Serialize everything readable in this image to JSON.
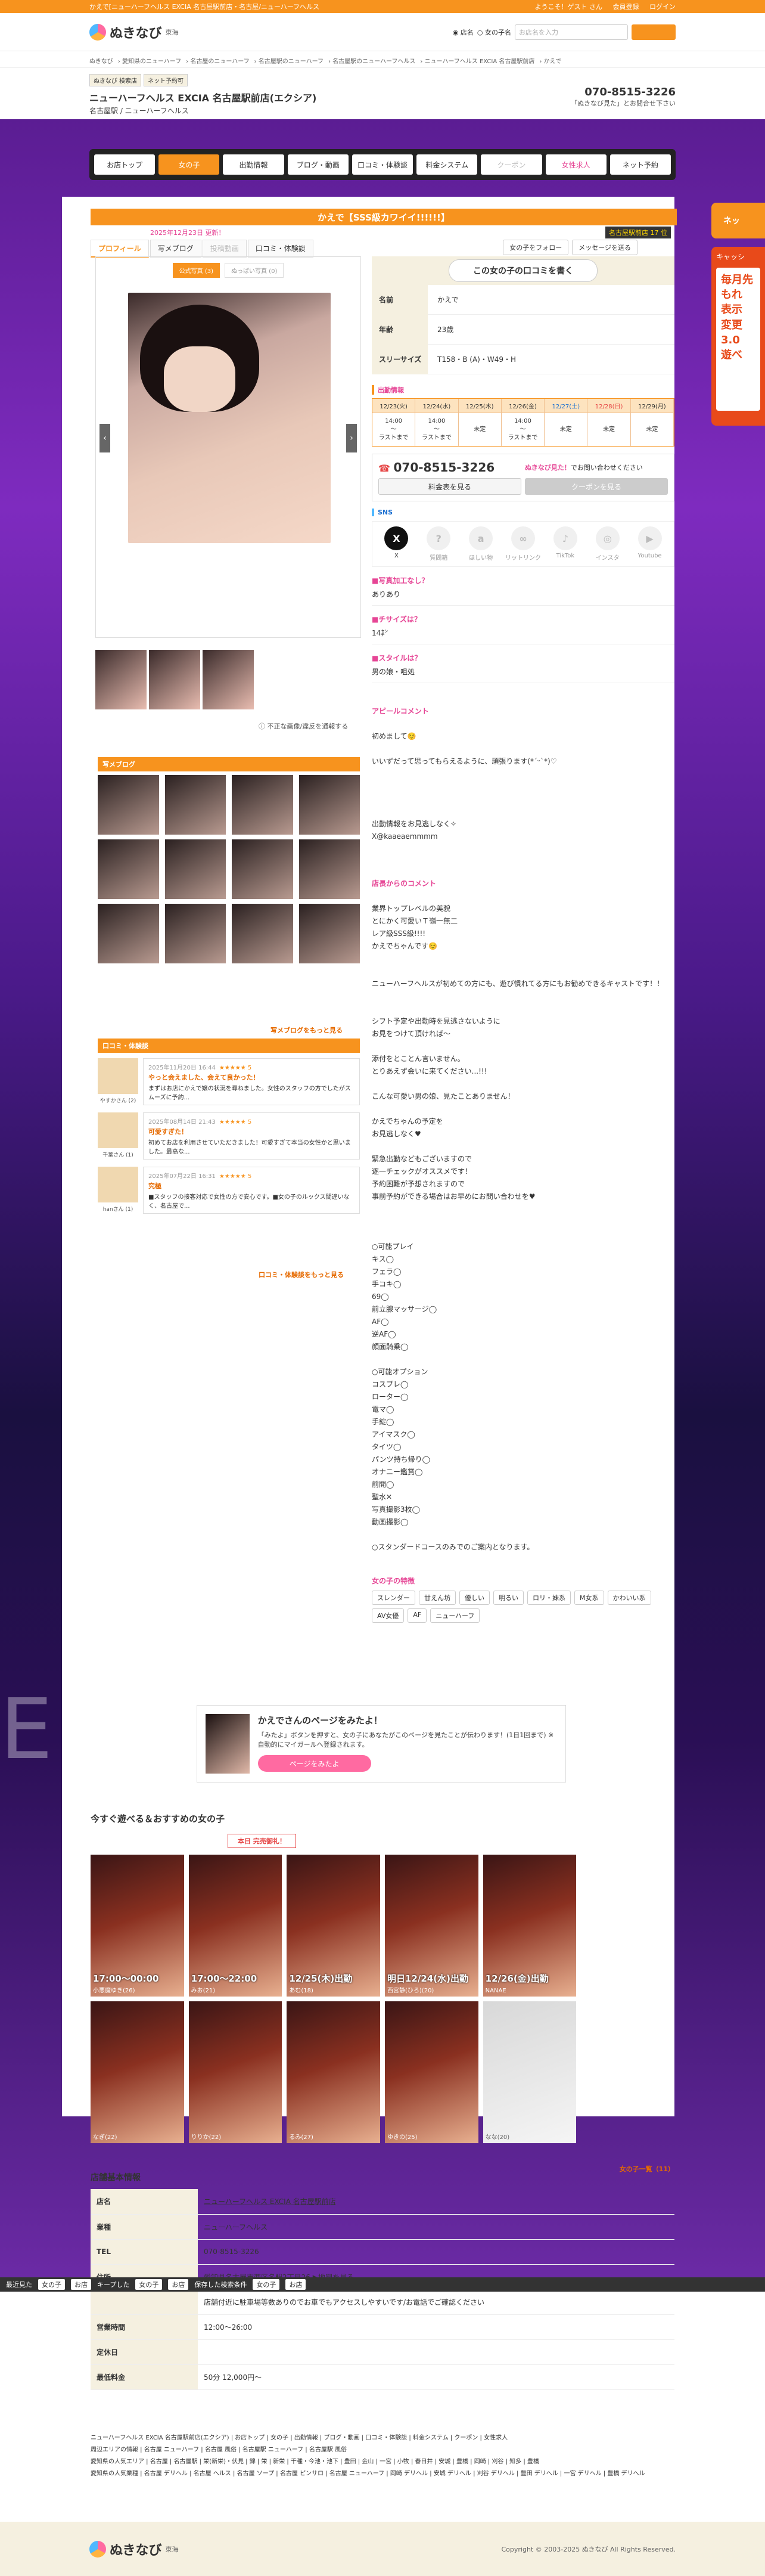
{
  "topline": {
    "left": "かえで[ニューハーフヘルス EXCIA 名古屋駅前店・名古屋/ニューハーフヘルス",
    "links": [
      "ようこそ！ゲスト さん",
      "会員登録",
      "ログイン"
    ]
  },
  "header": {
    "logo": "ぬきなび",
    "region": "東海",
    "search_scope_1": "店名",
    "search_scope_2": "女の子名",
    "search_placeholder": "お店名を入力"
  },
  "breadcrumb": [
    "ぬきなび",
    "愛知県のニューハーフ",
    "名古屋のニューハーフ",
    "名古屋駅のニューハーフ",
    "名古屋駅のニューハーフヘルス",
    "ニューハーフヘルス EXCIA 名古屋駅前店",
    "かえで"
  ],
  "shop": {
    "tags": [
      "ぬきなび 検索店",
      "ネット予約可"
    ],
    "name": "ニューハーフヘルス EXCIA 名古屋駅前店(エクシア)",
    "sub": "名古屋駅 / ニューハーフヘルス",
    "tel": "070-8515-3226",
    "tel_note": "「ぬきなび見た」とお問合せ下さい"
  },
  "nav": [
    {
      "label": "お店トップ",
      "state": "normal"
    },
    {
      "label": "女の子",
      "state": "on"
    },
    {
      "label": "出勤情報",
      "state": "normal"
    },
    {
      "label": "ブログ・動画",
      "state": "normal"
    },
    {
      "label": "口コミ・体験談",
      "state": "normal"
    },
    {
      "label": "料金システム",
      "state": "normal"
    },
    {
      "label": "クーポン",
      "state": "dim"
    },
    {
      "label": "女性求人",
      "state": "pink"
    },
    {
      "label": "ネット予約",
      "state": "normal"
    }
  ],
  "girl": {
    "banner": "かえで【SSS級カワイイ!!!!!!】",
    "updated": "2025年12月23日 更新！",
    "rank": "名古屋駅前店 17 位",
    "tabs": [
      {
        "label": "プロフィール",
        "state": "on"
      },
      {
        "label": "写メブログ",
        "state": "normal"
      },
      {
        "label": "投稿動画",
        "state": "dim"
      },
      {
        "label": "口コミ・体験談",
        "state": "normal"
      }
    ],
    "follow": "女の子をフォロー",
    "message": "メッセージを送る",
    "photo_tabs": [
      "公式写真 (3)",
      "ぬっぱい写真 (0)"
    ],
    "report": "不正な画像/違反を通報する",
    "review_button": "この女の子の口コミを書く",
    "profile": [
      {
        "k": "名前",
        "v": "かえで"
      },
      {
        "k": "年齢",
        "v": "23歳"
      },
      {
        "k": "スリーサイズ",
        "v": "T158・B (A)・W49・H"
      }
    ],
    "schedule_title": "出勤情報",
    "schedule": [
      {
        "d": "12/23(火)",
        "t": "14:00\n〜\nラストまで",
        "k": "normal"
      },
      {
        "d": "12/24(水)",
        "t": "14:00\n〜\nラストまで",
        "k": "normal"
      },
      {
        "d": "12/25(木)",
        "t": "未定",
        "k": "normal"
      },
      {
        "d": "12/26(金)",
        "t": "14:00\n〜\nラストまで",
        "k": "normal"
      },
      {
        "d": "12/27(土)",
        "t": "未定",
        "k": "sat"
      },
      {
        "d": "12/28(日)",
        "t": "未定",
        "k": "sun"
      },
      {
        "d": "12/29(月)",
        "t": "未定",
        "k": "normal"
      }
    ],
    "tel": "070-8515-3226",
    "tel_note_b": "ぬきなび見た！",
    "tel_note_rest": "でお問い合わせください",
    "price_button": "料金表を見る",
    "coupon_button": "クーポンを見る",
    "sns_title": "SNS",
    "sns": [
      {
        "icon": "x-icon",
        "label": "X",
        "g": "X",
        "active": true
      },
      {
        "icon": "chat-icon",
        "label": "質問箱",
        "g": "?",
        "active": false
      },
      {
        "icon": "amazon-icon",
        "label": "ほしい物",
        "g": "a",
        "active": false
      },
      {
        "icon": "link-icon",
        "label": "リットリンク",
        "g": "∞",
        "active": false
      },
      {
        "icon": "tiktok-icon",
        "label": "TikTok",
        "g": "♪",
        "active": false
      },
      {
        "icon": "instagram-icon",
        "label": "インスタ",
        "g": "◎",
        "active": false
      },
      {
        "icon": "youtube-icon",
        "label": "Youtube",
        "g": "▶",
        "active": false
      }
    ],
    "qa": [
      {
        "q": "■写真加工なし？",
        "a": "ありあり"
      },
      {
        "q": "■チサイズは？",
        "a": "14㌢"
      },
      {
        "q": "■スタイルは？",
        "a": "男の娘・咀処"
      }
    ],
    "appeal_title": "アピールコメント",
    "appeal": "初めまして☺️\n\nいいずだって思ってもらえるように、頑張ります(*ˊᵕˋ*)♡\n\n\n\n\n出勤情報をお見逃しなく✧\nX@kaaeaemmmm",
    "shop_comment_title": "店長からのコメント",
    "shop_comment": "業界トップレベルの美貌\nとにかく可愛いＴ嶺一無二\nレア級SSS級!!!!\nかえでちゃんです☺️\n\n\nニューハーフヘルスが初めての方にも、遊び慣れてる方にもお勧めできるキャストです！！\n\n\nシフト予定や出勤時を見逃さないように\nお見をつけて頂ければ〜\n\n添付をとことん言いません。\nとりあえず会いに来てください...!!!\n\nこんな可愛い男の娘、見たことありません！\n\nかえでちゃんの予定を\nお見逃しなく♥\n\n緊急出勤などもございますので\n逐一チェックがオススメです！\n予約困難が予想されますので\n事前予約ができる場合はお早めにお問い合わせを♥\n\n\n\n○可能プレイ\nキス◯\nフェラ◯\n手コキ◯\n69◯\n前立腺マッサージ◯\nAF◯\n逆AF◯\n顔面騎乗◯\n\n○可能オプション\nコスプレ◯\nローター◯\n電マ◯\n手錠◯\nアイマスク◯\nタイツ◯\nパンツ持ち帰り◯\nオナニー鑑賞◯\n前開◯\n聖水✕\n写真撮影3枚◯\n動画撮影◯\n\n○スタンダードコースのみでのご案内となります。",
    "features_title": "女の子の特徴",
    "features": [
      "スレンダー",
      "甘えん坊",
      "優しい",
      "明るい",
      "ロリ・妹系",
      "M女系",
      "かわいい系",
      "AV女優",
      "AF",
      "ニューハーフ"
    ]
  },
  "blog": {
    "title": "写メブログ",
    "more": "写メブログをもっと見る"
  },
  "reviews": {
    "title": "口コミ・体験談",
    "items": [
      {
        "name": "やすかさん (2)",
        "date": "2025年11月20日 16:44",
        "stars": "★★★★★ 5",
        "title": "やっと会えました、会えて良かった！",
        "text": "まずはお店にかえで嬢の状況を尋ねました。女性のスタッフの方でしたがスムーズに予約..."
      },
      {
        "name": "千葉さん (1)",
        "date": "2025年08月14日 21:43",
        "stars": "★★★★★ 5",
        "title": "可愛すぎた！",
        "text": "初めてお店を利用させていただきました！可愛すぎて本当の女性かと思いました。最高な..."
      },
      {
        "name": "hanさん (1)",
        "date": "2025年07月22日 16:31",
        "stars": "★★★★★ 5",
        "title": "究極",
        "text": "■スタッフの接客対応で女性の方で安心です。■女の子のルックス間違いなく、名古屋で..."
      }
    ],
    "more": "口コミ・体験談をもっと見る"
  },
  "promo": {
    "title": "かえでさんのページをみたよ！",
    "text": "「みたよ」ボタンを押すと、女の子にあなたがこのページを見たことが伝わります！(1日1回まで) ※自動的にマイガールへ登録されます。",
    "button": "ページをみたよ"
  },
  "recommend": {
    "title": "今すぐ遊べる＆おすすめの女の子",
    "hot": "本日 完売御礼！",
    "girls": [
      {
        "time": "17:00〜00:00",
        "name": "小悪魔ゆき(26)"
      },
      {
        "time": "17:00〜22:00",
        "name": "みお(21)"
      },
      {
        "time": "12/25(木)出勤",
        "name": "あむ(18)"
      },
      {
        "time": "明日12/24(水)出勤",
        "name": "西宮静(ひろ)(20)"
      },
      {
        "time": "12/26(金)出勤",
        "name": "NANAE"
      },
      {
        "time": "",
        "name": "なぎ(22)"
      },
      {
        "time": "",
        "name": "りりか(22)"
      },
      {
        "time": "",
        "name": "るみ(27)"
      },
      {
        "time": "",
        "name": "ゆきの(25)"
      },
      {
        "time": "",
        "name": "なな(20)"
      }
    ],
    "more": "女の子一覧（11）"
  },
  "shopinfo": {
    "title": "店舗基本情報",
    "rows": [
      {
        "k": "店名",
        "v": "ニューハーフヘルス EXCIA 名古屋駅前店"
      },
      {
        "k": "業種",
        "v": "ニューハーフヘルス"
      },
      {
        "k": "TEL",
        "v": "070-8515-3226"
      },
      {
        "k": "住所",
        "v": "愛知県名古屋市西区名駅2丁目26 ▶地図を見る"
      },
      {
        "k": "",
        "v": "店舗付近に駐車場等数ありのでお車でもアクセスしやすいです/お電話でご確認ください"
      },
      {
        "k": "営業時間",
        "v": "12:00〜26:00"
      },
      {
        "k": "定休日",
        "v": ""
      },
      {
        "k": "最低料金",
        "v": "50分 12,000円〜"
      }
    ]
  },
  "floatbar": {
    "items": [
      "最近見た",
      "女の子",
      "お店",
      "キープした",
      "女の子",
      "お店",
      "保存した検索条件",
      "女の子",
      "お店"
    ]
  },
  "side": {
    "tab": "ネッ",
    "ad_title": "キャッシ",
    "ad_body": "毎月先\nもれ\n表示\n変更 3.0\n遊べ"
  },
  "footer_links": [
    "ニューハーフヘルス EXCIA 名古屋駅前店(エクシア) | お店トップ | 女の子 | 出勤情報 | ブログ・動画 | 口コミ・体験談 | 料金システム | クーポン | 女性求人",
    "周辺エリアの情報 | 名古屋 ニューハーフ | 名古屋 風俗 | 名古屋駅 ニューハーフ | 名古屋駅 風俗",
    "愛知県の人気エリア | 名古屋 | 名古屋駅 | 栄(新栄)・伏見 | 錦 | 栄 | 新栄 | 千種・今池・池下 | 豊田 | 金山 | 一宮 | 小牧 | 春日井 | 安城 | 豊橋 | 岡崎 | 刈谷 | 知多 | 豊橋",
    "愛知県の人気業種 | 名古屋 デリヘル | 名古屋 ヘルス | 名古屋 ソープ | 名古屋 ピンサロ | 名古屋 ニューハーフ | 岡崎 デリヘル | 安城 デリヘル | 刈谷 デリヘル | 豊田 デリヘル | 一宮 デリヘル | 豊橋 デリヘル"
  ],
  "footer": {
    "logo": "ぬきなび",
    "region": "東海",
    "copy": "Copyright © 2003-2025 ぬきなび All Rights Reserved."
  },
  "colors": {
    "accent": "#f7931e",
    "pink": "#e64595",
    "hero_top": "#5b1d93"
  }
}
